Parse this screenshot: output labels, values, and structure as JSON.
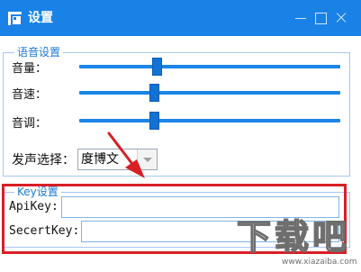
{
  "window": {
    "title": "设置",
    "title_bar_color": "#1a82e6",
    "controls": [
      "minimize-icon",
      "maximize-icon",
      "close-icon"
    ]
  },
  "voice_settings": {
    "legend": "语音设置",
    "volume": {
      "label": "音量：",
      "value_fraction": 0.29
    },
    "speed": {
      "label": "音速：",
      "value_fraction": 0.28
    },
    "pitch": {
      "label": "音调：",
      "value_fraction": 0.28
    },
    "voice_select": {
      "label": "发声选择：",
      "value": "度博文"
    }
  },
  "key_settings": {
    "legend": "Key设置",
    "api_key": {
      "label": "ApiKey:",
      "value": ""
    },
    "secret_key": {
      "label": "SecertKey:",
      "value": ""
    }
  },
  "annotation": {
    "color": "#d81f26"
  },
  "watermark": {
    "text": "下载吧",
    "url": "www.xiazaiba.com"
  }
}
